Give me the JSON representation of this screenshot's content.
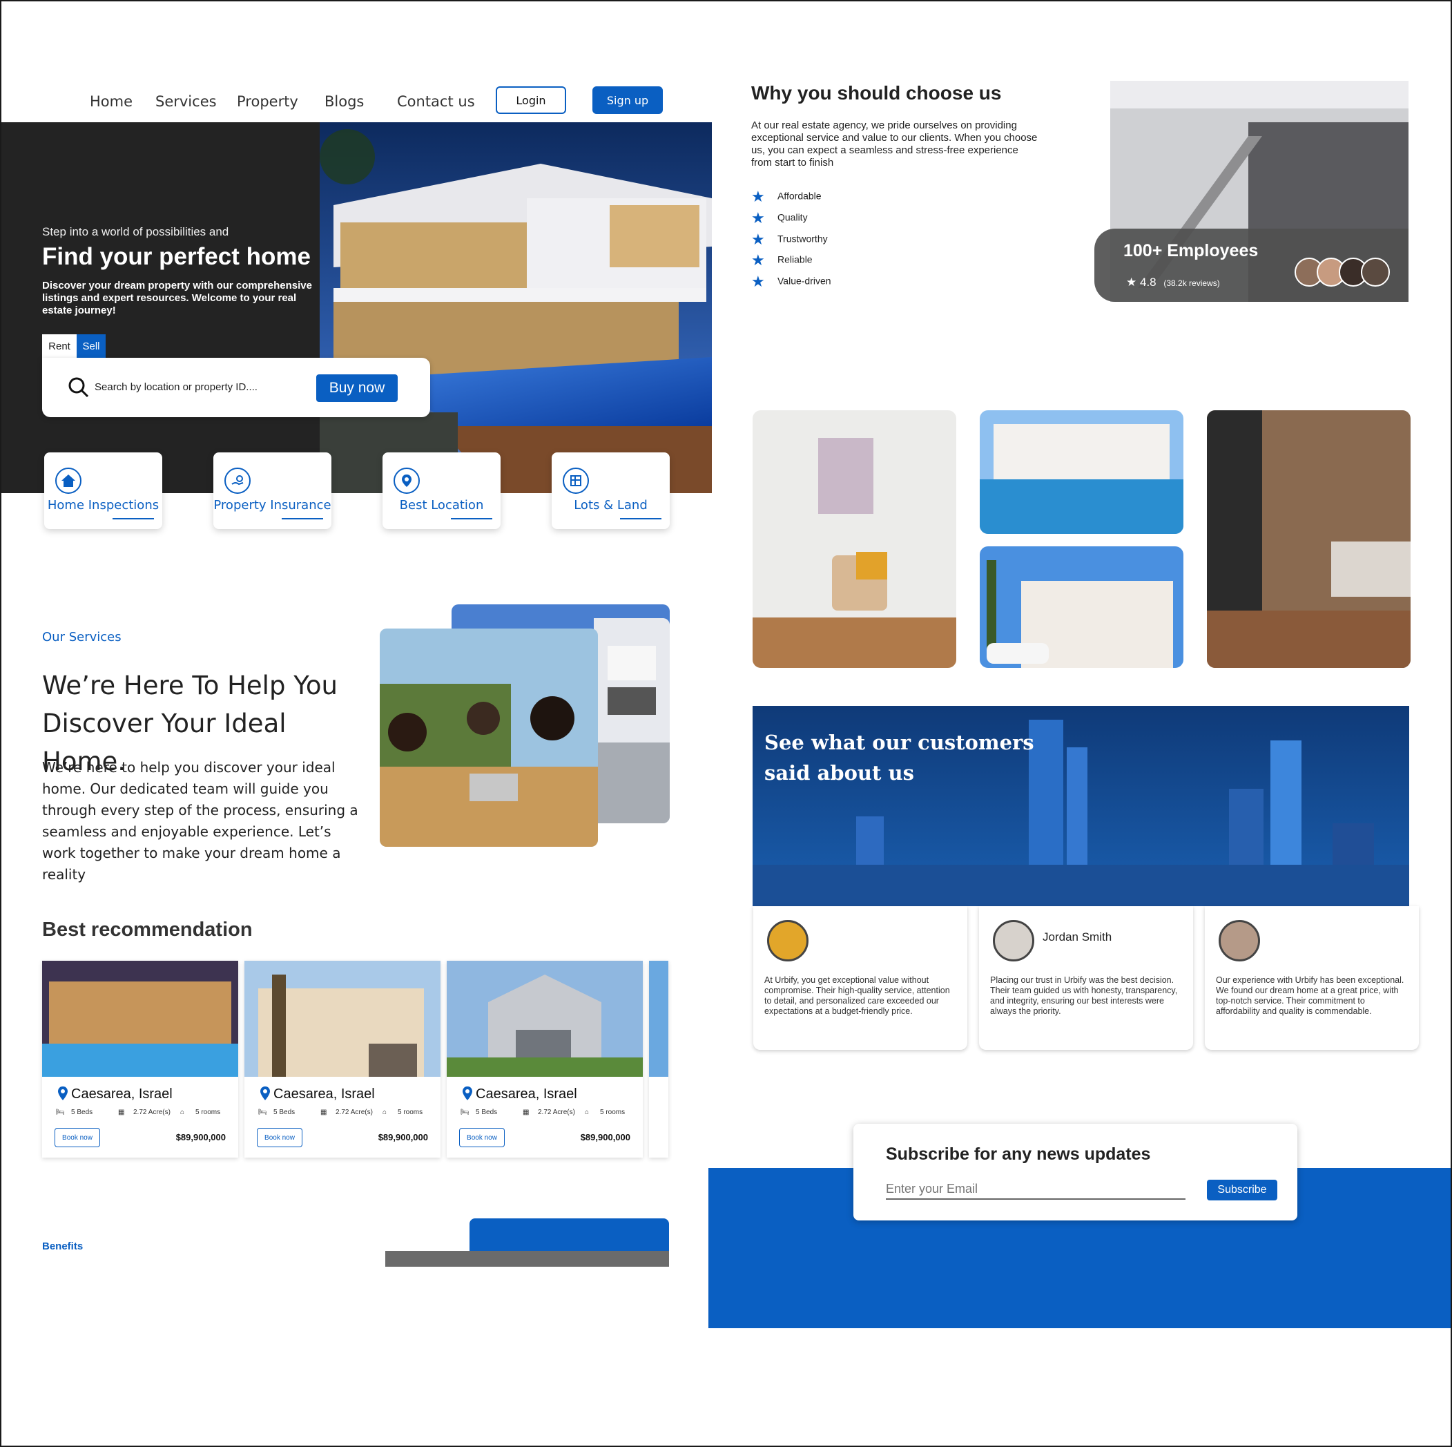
{
  "nav": {
    "links": [
      "Home",
      "Services",
      "Property",
      "Blogs",
      "Contact us"
    ],
    "login": "Login",
    "signup": "Sign up"
  },
  "hero": {
    "kicker": "Step into a world of possibilities and",
    "title": "Find your perfect home",
    "description": "Discover your dream property with our comprehensive listings and expert resources. Welcome to your real estate journey!",
    "tabs": [
      "Rent",
      "Sell"
    ],
    "active_tab": "Sell",
    "search_placeholder": "Search by location or property ID....",
    "buy_button": "Buy now"
  },
  "service_cards": [
    {
      "label": "Home Inspections",
      "icon": "house-icon"
    },
    {
      "label": "Property Insurance",
      "icon": "insurance-icon"
    },
    {
      "label": "Best Location",
      "icon": "location-pin-icon"
    },
    {
      "label": "Lots & Land",
      "icon": "land-plot-icon"
    }
  ],
  "our_services": {
    "kicker": "Our Services",
    "heading": "We’re Here To Help You Discover Your Ideal Home.",
    "body": "We’re here to help you discover your ideal home. Our dedicated team will guide you through every step of the process, ensuring a seamless and enjoyable experience. Let’s work together to make your dream home a reality"
  },
  "recommendation": {
    "heading": "Best recommendation",
    "cards": [
      {
        "location": "Caesarea, Israel",
        "beds": "5 Beds",
        "area": "2.72 Acre(s)",
        "rooms": "5 rooms",
        "book": "Book now",
        "price": "$89,900,000"
      },
      {
        "location": "Caesarea, Israel",
        "beds": "5 Beds",
        "area": "2.72 Acre(s)",
        "rooms": "5 rooms",
        "book": "Book now",
        "price": "$89,900,000"
      },
      {
        "location": "Caesarea, Israel",
        "beds": "5 Beds",
        "area": "2.72 Acre(s)",
        "rooms": "5 rooms",
        "book": "Book now",
        "price": "$89,900,000"
      }
    ]
  },
  "benefits": {
    "kicker": "Benefits"
  },
  "why": {
    "heading": "Why you should choose us",
    "body": "At our real estate agency, we pride ourselves on providing exceptional service and value to our clients. When you choose us, you can expect a seamless and stress-free experience from start to finish",
    "items": [
      "Affordable",
      "Quality",
      "Trustworthy",
      "Reliable",
      "Value-driven"
    ],
    "employees": "100+ Employees",
    "rating": "4.8",
    "reviews": "(38.2k reviews)"
  },
  "testimonials": {
    "heading": "See what our customers said about us",
    "items": [
      {
        "name": "",
        "text": "At Urbify, you get exceptional value without compromise. Their high-quality service, attention to detail, and personalized care exceeded our expectations at a budget-friendly price."
      },
      {
        "name": "Jordan Smith",
        "text": "Placing our trust in Urbify was the best decision. Their team guided us with honesty, transparency, and integrity, ensuring our best interests were always the priority."
      },
      {
        "name": "",
        "text": "Our experience with Urbify has been exceptional. We found our dream home at a great price, with top-notch service. Their commitment to affordability and quality is commendable."
      }
    ]
  },
  "subscribe": {
    "heading": "Subscribe for any news updates",
    "placeholder": "Enter your Email",
    "button": "Subscribe"
  },
  "colors": {
    "primary": "#0a5fc2",
    "dark": "#232323"
  }
}
